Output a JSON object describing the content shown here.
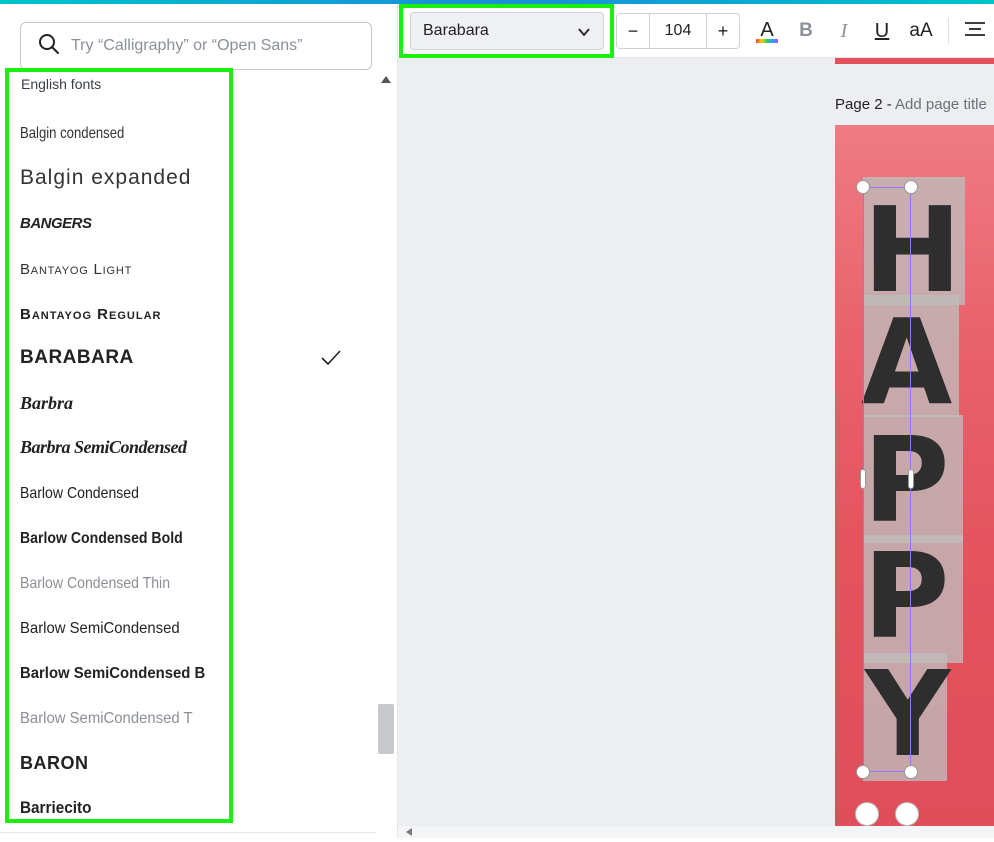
{
  "search": {
    "placeholder": "Try “Calligraphy” or “Open Sans”"
  },
  "font_list": {
    "section_title": "English fonts",
    "items": [
      {
        "label": "Balgin condensed"
      },
      {
        "label": "Balgin expanded"
      },
      {
        "label": "BANGERS"
      },
      {
        "label": "Bantayog Light"
      },
      {
        "label": "Bantayog Regular"
      },
      {
        "label": "BARABARA",
        "selected": true
      },
      {
        "label": "Barbra"
      },
      {
        "label": "Barbra SemiCondensed"
      },
      {
        "label": "Barlow Condensed"
      },
      {
        "label": "Barlow Condensed Bold"
      },
      {
        "label": "Barlow Condensed Thin"
      },
      {
        "label": "Barlow SemiCondensed"
      },
      {
        "label": "Barlow SemiCondensed B"
      },
      {
        "label": "Barlow SemiCondensed T"
      },
      {
        "label": "BARON"
      },
      {
        "label": "Barriecito"
      }
    ]
  },
  "toolbar": {
    "font_name": "Barabara",
    "font_size": "104",
    "minus_label": "−",
    "plus_label": "+",
    "color_label": "A",
    "bold_label": "B",
    "italic_label": "I",
    "underline_label": "U",
    "case_label": "aA"
  },
  "canvas": {
    "page_prefix": "Page 2 - ",
    "page_title_placeholder": "Add page title",
    "letters": [
      "H",
      "A",
      "P",
      "P",
      "Y"
    ]
  },
  "colors": {
    "highlight": "#19f00f",
    "page_bg": "#e4535e",
    "letter": "#2e2e2e",
    "selection": "#8a7cf0"
  }
}
